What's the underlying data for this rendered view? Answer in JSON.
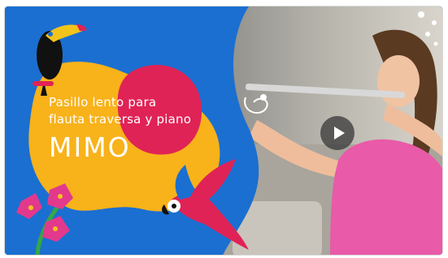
{
  "card": {
    "subtitle": "Pasillo lento para\nflauta traversa y piano",
    "title": "MIMO"
  },
  "video": {
    "play_icon": "play-icon"
  },
  "colors": {
    "background_blue": "#1b6fd1",
    "accent_yellow": "#f8b21a",
    "accent_pink": "#e02356",
    "flower_pink": "#e3398c",
    "leaf_green": "#35a844"
  }
}
